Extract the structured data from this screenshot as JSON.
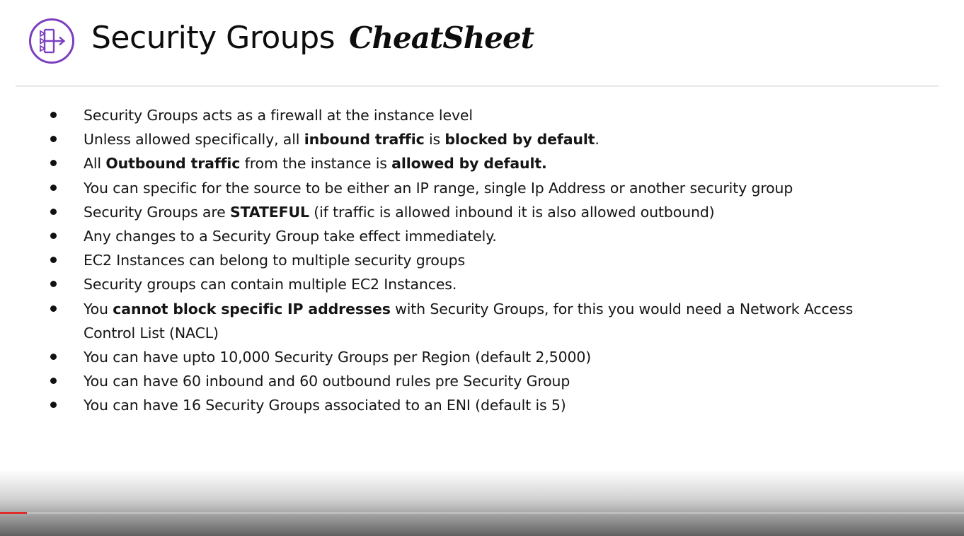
{
  "header": {
    "title": "Security Groups",
    "title_script": "CheatSheet",
    "logo_icon": "security-group-icon",
    "accent_color": "#7b3fbf"
  },
  "bullets": [
    [
      {
        "t": "Security Groups acts as a firewall at the instance level"
      }
    ],
    [
      {
        "t": "Unless allowed specifically, all "
      },
      {
        "t": "inbound traffic",
        "b": true
      },
      {
        "t": " is "
      },
      {
        "t": "blocked by default",
        "b": true
      },
      {
        "t": "."
      }
    ],
    [
      {
        "t": "All "
      },
      {
        "t": "Outbound traffic",
        "b": true
      },
      {
        "t": " from the instance is "
      },
      {
        "t": "allowed by default.",
        "b": true
      }
    ],
    [
      {
        "t": "You can specific for the source to be either an IP range, single Ip Address or another security group"
      }
    ],
    [
      {
        "t": "Security Groups are "
      },
      {
        "t": "STATEFUL",
        "b": true
      },
      {
        "t": "  (if traffic is allowed inbound it is also allowed outbound)"
      }
    ],
    [
      {
        "t": "Any changes to a Security Group take effect immediately."
      }
    ],
    [
      {
        "t": "EC2 Instances can belong to multiple security groups"
      }
    ],
    [
      {
        "t": "Security groups can contain multiple EC2 Instances."
      }
    ],
    [
      {
        "t": "You "
      },
      {
        "t": "cannot block specific IP addresses",
        "b": true
      },
      {
        "t": " with Security Groups, for this you would need a Network Access Control List (NACL)"
      }
    ],
    [
      {
        "t": "You can have upto 10,000 Security Groups per Region (default 2,5000)"
      }
    ],
    [
      {
        "t": "You can have 60 inbound and 60 outbound rules pre Security Group"
      }
    ],
    [
      {
        "t": "You can have 16 Security Groups associated to an ENI (default is 5)"
      }
    ]
  ],
  "video": {
    "progress_fraction": 0.028,
    "progress_color": "#e02b2b"
  }
}
